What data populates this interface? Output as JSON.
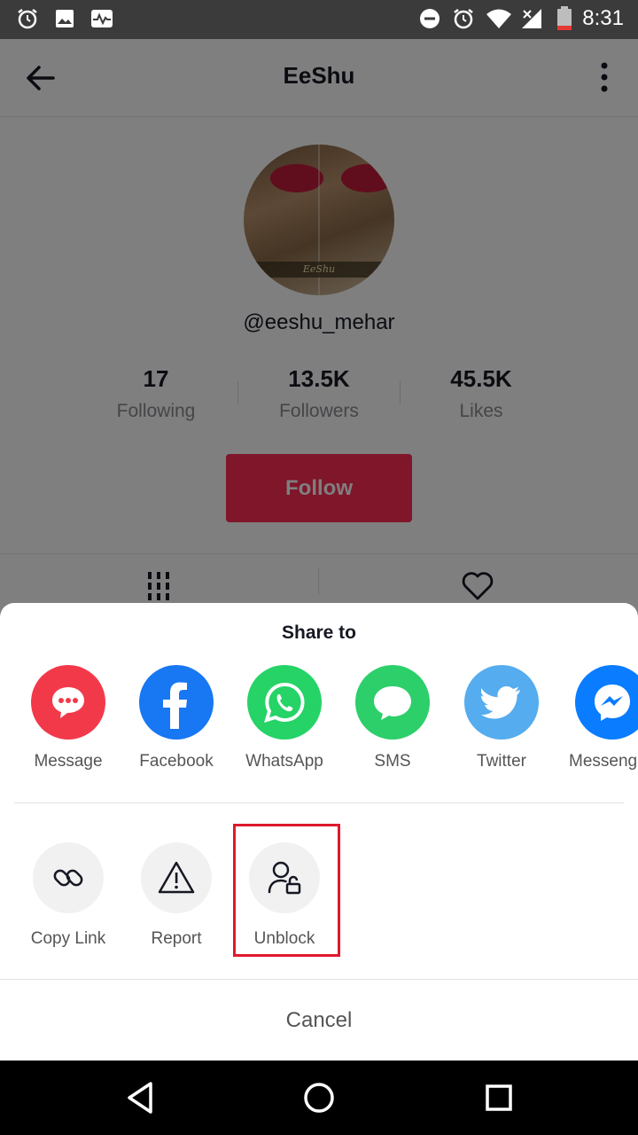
{
  "status_bar": {
    "time": "8:31",
    "left_icons": [
      "alarm-icon",
      "image-icon",
      "pulse-icon"
    ],
    "right_icons": [
      "dnd-icon",
      "alarm-icon",
      "wifi-icon",
      "signal-icon",
      "battery-icon"
    ],
    "battery_color": "#e53935"
  },
  "profile": {
    "title": "EeShu",
    "avatar_caption": "EeShu",
    "handle": "@eeshu_mehar",
    "stats": [
      {
        "value": "17",
        "label": "Following"
      },
      {
        "value": "13.5K",
        "label": "Followers"
      },
      {
        "value": "45.5K",
        "label": "Likes"
      }
    ],
    "follow_label": "Follow",
    "tabs": [
      "grid-icon",
      "heart-icon"
    ]
  },
  "share_sheet": {
    "title": "Share to",
    "targets": [
      {
        "label": "Message",
        "icon": "message-icon",
        "color": "#f2394a"
      },
      {
        "label": "Facebook",
        "icon": "facebook-icon",
        "color": "#1877f2"
      },
      {
        "label": "WhatsApp",
        "icon": "whatsapp-icon",
        "color": "#25d366"
      },
      {
        "label": "SMS",
        "icon": "sms-icon",
        "color": "#2ccf6a"
      },
      {
        "label": "Twitter",
        "icon": "twitter-icon",
        "color": "#55acee"
      },
      {
        "label": "Messeng",
        "icon": "messenger-icon",
        "color": "#0a7cff"
      }
    ],
    "actions": [
      {
        "label": "Copy Link",
        "icon": "link-icon"
      },
      {
        "label": "Report",
        "icon": "warning-icon"
      },
      {
        "label": "Unblock",
        "icon": "user-unlock-icon"
      }
    ],
    "highlight_color": "#e0182d",
    "cancel_label": "Cancel"
  },
  "system_nav": [
    "back-icon",
    "home-icon",
    "recents-icon"
  ]
}
